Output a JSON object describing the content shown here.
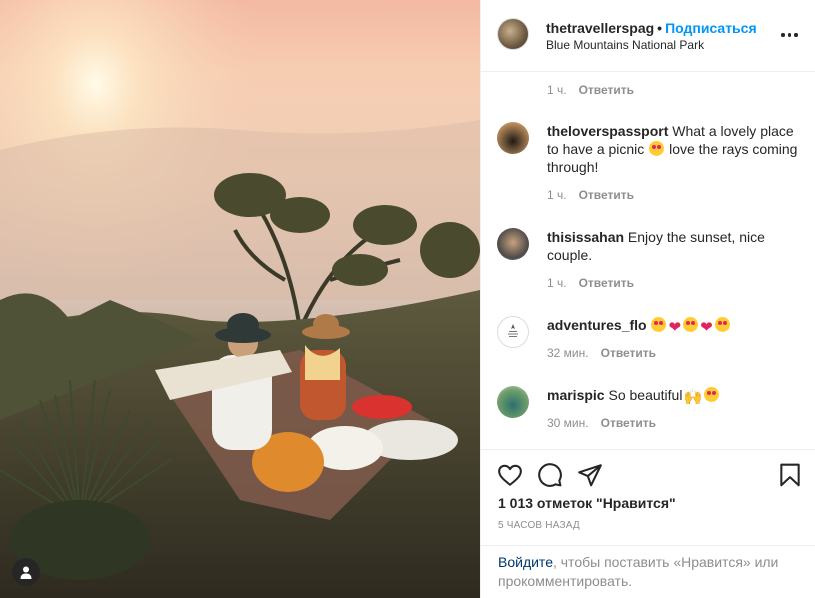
{
  "post": {
    "image_alt": "Couple having a picnic on a mountain cliff at sunset",
    "user_tag_icon": "user-icon"
  },
  "header": {
    "username": "thetravellerspag",
    "separator": "•",
    "follow_label": "Подписаться",
    "location": "Blue Mountains National Park",
    "more_icon": "more-horizontal-icon"
  },
  "comments": {
    "top_meta": {
      "time": "1 ч.",
      "reply": "Ответить"
    },
    "items": [
      {
        "username": "theloverspassport",
        "text_before": "What a lovely place to have a picnic",
        "text_after": "love the rays coming through!",
        "time": "1 ч.",
        "reply": "Ответить"
      },
      {
        "username": "thisissahan",
        "text": "Enjoy the sunset, nice couple.",
        "time": "1 ч.",
        "reply": "Ответить"
      },
      {
        "username": "adventures_flo",
        "text": "",
        "time": "32 мин.",
        "reply": "Ответить"
      },
      {
        "username": "marispic",
        "text": "So beautiful",
        "time": "30 мин.",
        "reply": "Ответить"
      }
    ]
  },
  "actions": {
    "like_icon": "heart-icon",
    "comment_icon": "comment-icon",
    "share_icon": "share-icon",
    "save_icon": "bookmark-icon",
    "likes": "1 013 отметок \"Нравится\"",
    "time_ago": "5 ЧАСОВ НАЗАД"
  },
  "login": {
    "link": "Войдите",
    "text": ", чтобы поставить «Нравится» или прокомментировать."
  },
  "colors": {
    "link_blue": "#0095f6",
    "text": "#262626",
    "muted": "#8e8e8e",
    "border": "#efefef"
  }
}
